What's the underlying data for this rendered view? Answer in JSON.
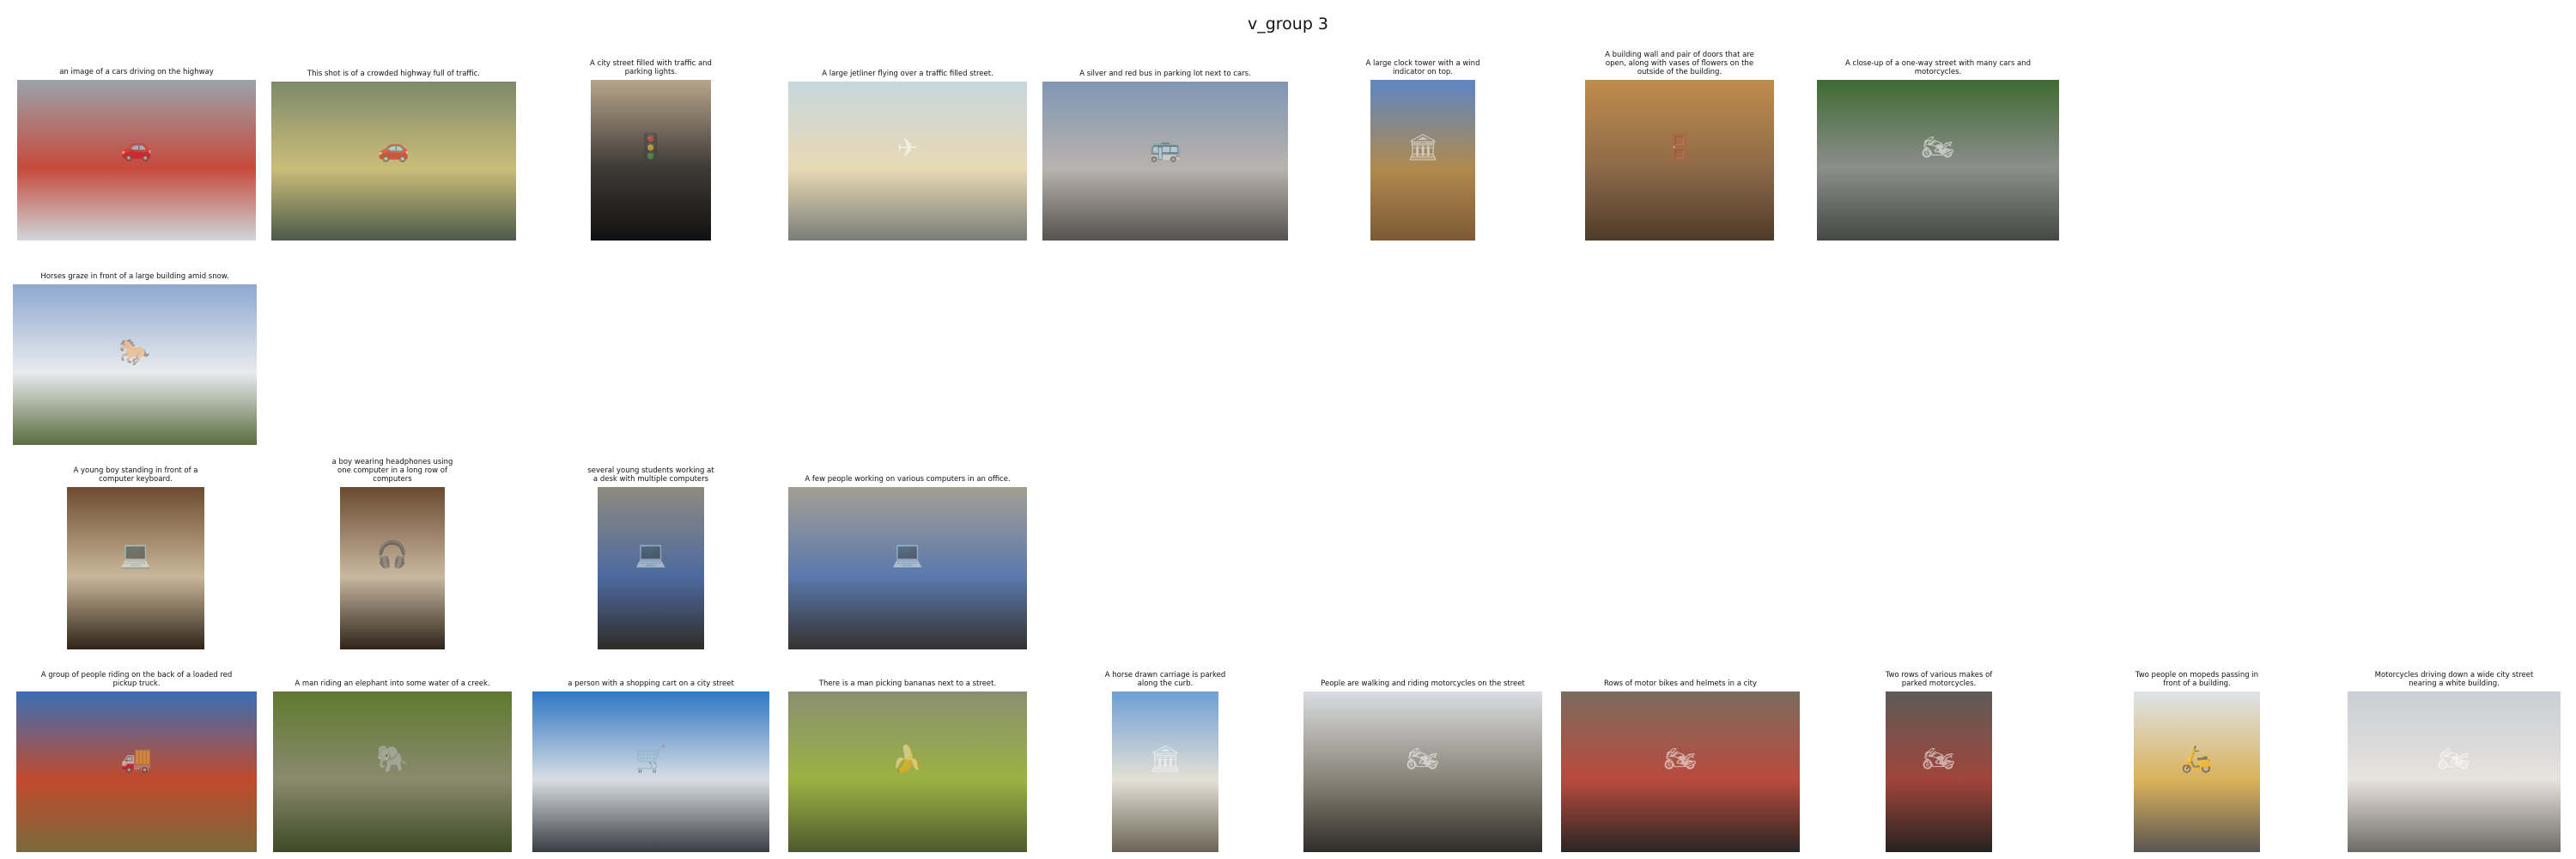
{
  "figure": {
    "title": "v_group 3"
  },
  "rows": [
    {
      "items": [
        {
          "caption": "an image of a cars driving on the highway",
          "icon": "car-icon",
          "scene": "busy highway with colorful cars",
          "colors": [
            "#9aa3aa",
            "#c64a3c",
            "#cfd6da"
          ]
        },
        {
          "caption": "This shot is of a crowded highway full of traffic.",
          "icon": "car-icon",
          "scene": "crowded highway traffic",
          "colors": [
            "#7d8a6a",
            "#cbbd7a",
            "#4c5a4a"
          ]
        },
        {
          "caption": "A city street filled with traffic and parking lights.",
          "icon": "traffic-light-icon",
          "scene": "dark street with traffic lights at dusk",
          "colors": [
            "#b7a58c",
            "#3e3a36",
            "#111111"
          ]
        },
        {
          "caption": "A large jetliner flying over a traffic filled street.",
          "icon": "airplane-icon",
          "scene": "jet over a street at sunset",
          "colors": [
            "#c7d7dd",
            "#e8d9b4",
            "#7a7e78"
          ]
        },
        {
          "caption": "A silver and red bus in parking lot next to cars.",
          "icon": "bus-icon",
          "scene": "silver and red bus in a lot",
          "colors": [
            "#7f97b4",
            "#b9b2ad",
            "#55524f"
          ]
        },
        {
          "caption": "A large clock tower with a wind indicator on top.",
          "icon": "tower-icon",
          "scene": "clock tower against blue sky",
          "colors": [
            "#5d86c4",
            "#b08a4e",
            "#7d5a36"
          ]
        },
        {
          "caption": "A building wall and pair of doors that are open, along with vases of flowers on the outside of the building.",
          "icon": "door-icon",
          "scene": "weathered wall with open doors",
          "colors": [
            "#c08c4c",
            "#8d6a48",
            "#4e3b2a"
          ]
        },
        {
          "caption": "A close-up of a one-way street with many cars and motorcycles.",
          "icon": "motorcycle-icon",
          "scene": "street with cars and motorcycles",
          "colors": [
            "#3f6b33",
            "#8c8e8c",
            "#464846"
          ]
        }
      ]
    },
    {
      "items": [
        {
          "caption": "Horses graze in front of a large building amid snow.",
          "icon": "horse-icon",
          "scene": "horses grazing before a white church",
          "colors": [
            "#8ea8cf",
            "#e8ebef",
            "#5a6d3e"
          ]
        }
      ]
    },
    {
      "items": [
        {
          "caption": "A young boy standing in front of a computer keyboard.",
          "icon": "computer-icon",
          "scene": "boy at a computer keyboard",
          "colors": [
            "#6d4b2e",
            "#c9b79a",
            "#2f2419"
          ]
        },
        {
          "caption": "a boy wearing headphones using one computer in a long row of computers",
          "icon": "headphones-icon",
          "scene": "boy with headphones at computers",
          "colors": [
            "#6a4a2f",
            "#c8b8a0",
            "#2e241a"
          ]
        },
        {
          "caption": "several young students working at a desk with multiple computers",
          "icon": "computer-icon",
          "scene": "students at desks with computers",
          "colors": [
            "#8e8a7e",
            "#4d6aa0",
            "#2f2c28"
          ]
        },
        {
          "caption": "A few people working on various computers in an office.",
          "icon": "computer-icon",
          "scene": "people working at office computers",
          "colors": [
            "#a39f93",
            "#5b79ad",
            "#353230"
          ]
        }
      ]
    },
    {
      "items": [
        {
          "caption": "A group of people riding on the back of a loaded red pickup truck.",
          "icon": "truck-icon",
          "scene": "loaded red pickup truck",
          "colors": [
            "#3a6fb5",
            "#c24a2c",
            "#7a6a3c"
          ]
        },
        {
          "caption": "A man riding an elephant into some water of a creek.",
          "icon": "elephant-icon",
          "scene": "man on elephant in creek",
          "colors": [
            "#5f7a2f",
            "#8a8a6e",
            "#3e4a26"
          ]
        },
        {
          "caption": "a person with a shopping cart on a city street",
          "icon": "cart-icon",
          "scene": "person with cart by blue wall",
          "colors": [
            "#2f77c4",
            "#d8dde3",
            "#3a3d44"
          ]
        },
        {
          "caption": "There is a man picking bananas next to a street.",
          "icon": "banana-icon",
          "scene": "man sorting green bananas",
          "colors": [
            "#8a8f70",
            "#9bb242",
            "#4e5a2e"
          ]
        },
        {
          "caption": "A horse drawn carriage is parked along the curb.",
          "icon": "carriage-icon",
          "scene": "baroque church and carriage",
          "colors": [
            "#6e9fd6",
            "#e4e0d6",
            "#6b6455"
          ]
        },
        {
          "caption": "People are walking and riding motorcycles on the street",
          "icon": "motorcycle-icon",
          "scene": "street between tall buildings",
          "colors": [
            "#d9dde2",
            "#8a8377",
            "#2f2c29"
          ]
        },
        {
          "caption": "Rows of motor bikes and helmets in a city",
          "icon": "motorcycle-icon",
          "scene": "rows of parked motorbikes",
          "colors": [
            "#7b6c5d",
            "#b94a3e",
            "#2a2623"
          ]
        },
        {
          "caption": "Two rows of various makes of parked motorcycles.",
          "icon": "motorcycle-icon",
          "scene": "two rows of parked motorcycles",
          "colors": [
            "#5e5a57",
            "#a0453b",
            "#262321"
          ]
        },
        {
          "caption": "Two people on mopeds passing in front of a building.",
          "icon": "scooter-icon",
          "scene": "mopeds before a yellow building",
          "colors": [
            "#dfe4e8",
            "#d9b25c",
            "#5a5550"
          ]
        },
        {
          "caption": "Motorcycles driving down a wide city street nearing a white building.",
          "icon": "motorcycle-icon",
          "scene": "wide street toward white building",
          "colors": [
            "#c9cfd6",
            "#e7e2dc",
            "#6e6a66"
          ]
        }
      ]
    }
  ]
}
